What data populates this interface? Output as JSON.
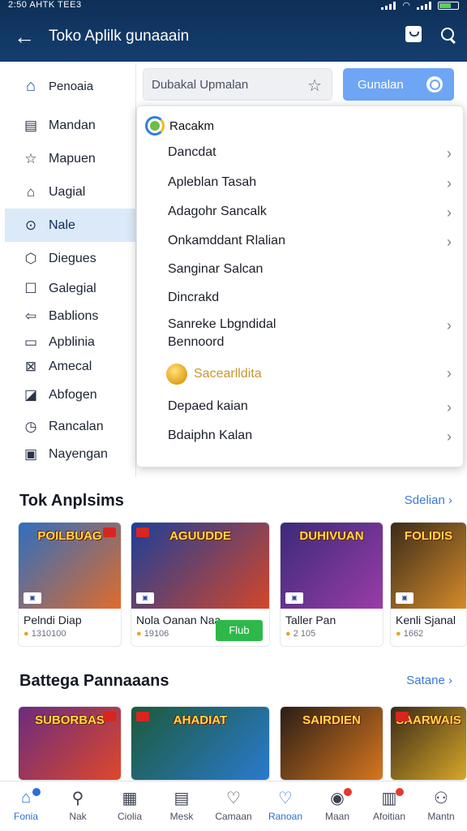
{
  "status": {
    "time_text": "2:50 AHTK TEE3"
  },
  "appbar": {
    "title": "Toko Aplilk gunaaain"
  },
  "sidebar": {
    "items": [
      {
        "label": "Penoaia",
        "icon": "home-icon"
      },
      {
        "label": "Mandan",
        "icon": "list-icon"
      },
      {
        "label": "Mapuen",
        "icon": "star-icon"
      },
      {
        "label": "Uagial",
        "icon": "tag-icon"
      },
      {
        "label": "Nale",
        "icon": "target-icon"
      },
      {
        "label": "Diegues",
        "icon": "shield-icon"
      },
      {
        "label": "Galegial",
        "icon": "square-icon"
      },
      {
        "label": "Bablions",
        "icon": "arrow-icon"
      },
      {
        "label": "Apblinia",
        "icon": "monitor-icon"
      },
      {
        "label": "Amecal",
        "icon": "close-box-icon"
      },
      {
        "label": "Abfogen",
        "icon": "image-icon"
      },
      {
        "label": "Rancalan",
        "icon": "clock-icon"
      },
      {
        "label": "Nayengan",
        "icon": "card-icon"
      }
    ]
  },
  "search": {
    "value": "Dubakal Upmalan",
    "button_label": "Gunalan"
  },
  "dropdown": {
    "header": "Racakm",
    "items": [
      {
        "label": "Dancdat",
        "chevron": true
      },
      {
        "label": "Apleblan Tasah",
        "chevron": true
      },
      {
        "label": "Adagohr Sancalk",
        "chevron": true
      },
      {
        "label": "Onkamddant Rlalian",
        "chevron": true
      },
      {
        "label": "Sanginar Salcan",
        "chevron": false
      },
      {
        "label": "Dincrakd",
        "chevron": false
      },
      {
        "label": "Sanreke Lbgndidal",
        "label2": "Bennoord",
        "chevron": true
      },
      {
        "label": "Sacearlldita",
        "chevron": true,
        "gold": true
      },
      {
        "label": "Depaed kaian",
        "chevron": true
      },
      {
        "label": "Bdaiphn Kalan",
        "chevron": true
      }
    ]
  },
  "section1": {
    "title": "Tok Anplsims",
    "see_all": "Sdelian",
    "cards": [
      {
        "art_title": "POILBUAG",
        "name": "Pelndi Diap",
        "meta": "1310100",
        "colors": [
          "#2d6fc1",
          "#e06b2b"
        ]
      },
      {
        "art_title": "AGUUDDE",
        "name": "Nola Oanan Naa",
        "meta": "19106",
        "button": "Flub",
        "colors": [
          "#1b3f9a",
          "#d3462a"
        ]
      },
      {
        "art_title": "DUHIVUAN",
        "name": "Taller Pan",
        "meta": "2 105",
        "colors": [
          "#3a2a7a",
          "#9b3ca6"
        ]
      },
      {
        "art_title": "FOLIDIS",
        "name": "Kenli Sjanal",
        "meta": "1662",
        "colors": [
          "#3a2b1a",
          "#d58b2a"
        ]
      }
    ]
  },
  "section2": {
    "title": "Battega Pannaaans",
    "see_all": "Satane",
    "cards": [
      {
        "art_title": "SUBORBAS",
        "colors": [
          "#6a2c7e",
          "#e0482a"
        ]
      },
      {
        "art_title": "AHADIAT",
        "colors": [
          "#1d5a3a",
          "#2a7ad0"
        ]
      },
      {
        "art_title": "SAIRDIEN",
        "colors": [
          "#2a1e16",
          "#d8771f"
        ]
      },
      {
        "art_title": "SAARWAIS",
        "colors": [
          "#3a2a16",
          "#d8a82a"
        ]
      }
    ]
  },
  "bottomnav": [
    {
      "label": "Fonia",
      "icon": "home-icon",
      "active": true,
      "dot": true
    },
    {
      "label": "Nak",
      "icon": "search-icon"
    },
    {
      "label": "Ciolia",
      "icon": "grid-icon"
    },
    {
      "label": "Mesk",
      "icon": "box-icon"
    },
    {
      "label": "Camaan",
      "icon": "heart-icon"
    },
    {
      "label": "Ranoan",
      "icon": "heart-outline-icon",
      "active": true
    },
    {
      "label": "Maan",
      "icon": "bell-icon",
      "dot": true
    },
    {
      "label": "Afoitian",
      "icon": "doc-icon",
      "dot": true
    },
    {
      "label": "Mantn",
      "icon": "user-icon"
    }
  ]
}
